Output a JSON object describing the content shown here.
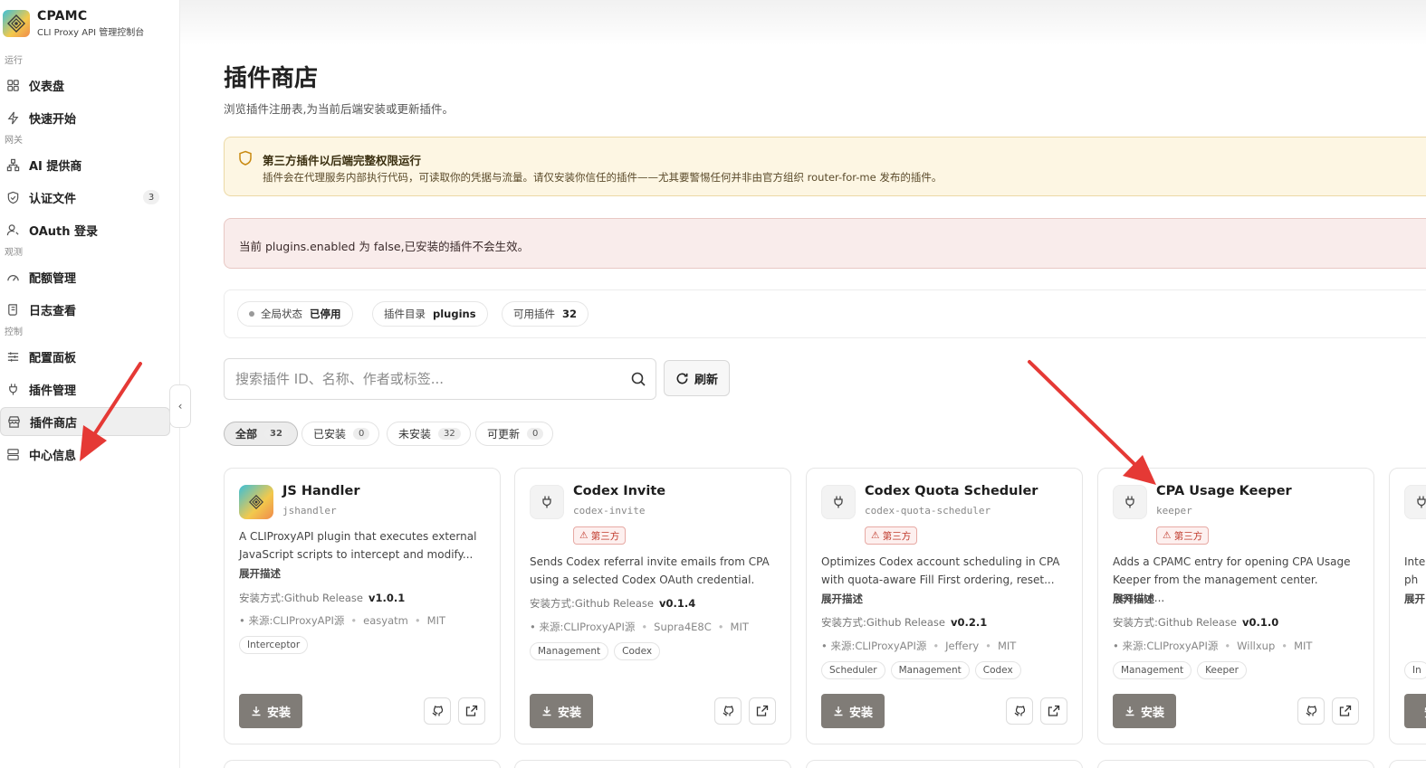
{
  "brand": {
    "name": "CPAMC",
    "subtitle": "CLI Proxy API 管理控制台"
  },
  "sidebar": {
    "sections": [
      {
        "label": "运行",
        "items": [
          {
            "label": "仪表盘"
          },
          {
            "label": "快速开始"
          }
        ]
      },
      {
        "label": "网关",
        "items": [
          {
            "label": "AI 提供商"
          },
          {
            "label": "认证文件",
            "count": "3"
          },
          {
            "label": "OAuth 登录"
          }
        ]
      },
      {
        "label": "观测",
        "items": [
          {
            "label": "配额管理"
          },
          {
            "label": "日志查看"
          }
        ]
      },
      {
        "label": "控制",
        "items": [
          {
            "label": "配置面板"
          },
          {
            "label": "插件管理"
          },
          {
            "label": "插件商店"
          },
          {
            "label": "中心信息"
          }
        ]
      }
    ],
    "active_item": "插件商店"
  },
  "page": {
    "title": "插件商店",
    "subtitle": "浏览插件注册表,为当前后端安装或更新插件。"
  },
  "warning": {
    "title": "第三方插件以后端完整权限运行",
    "description": "插件会在代理服务内部执行代码，可读取你的凭据与流量。请仅安装你信任的插件——尤其要警惕任何并非由官方组织 router-for-me 发布的插件。"
  },
  "error_notice": "当前 plugins.enabled 为 false,已安装的插件不会生效。",
  "status": {
    "global_label": "全局状态",
    "global_value": "已停用",
    "dir_label": "插件目录",
    "dir_value": "plugins",
    "available_label": "可用插件",
    "available_value": "32"
  },
  "search": {
    "placeholder": "搜索插件 ID、名称、作者或标签..."
  },
  "refresh_label": "刷新",
  "filters": [
    {
      "label": "全部",
      "count": "32"
    },
    {
      "label": "已安装",
      "count": "0"
    },
    {
      "label": "未安装",
      "count": "32"
    },
    {
      "label": "可更新",
      "count": "0"
    }
  ],
  "labels": {
    "third_party": "第三方",
    "expand": "展开描述",
    "install_method": "安装方式:",
    "source": "来源:",
    "install": "安装"
  },
  "plugins": [
    {
      "name": "JS Handler",
      "id": "jshandler",
      "third_party": false,
      "description": "A CLIProxyAPI plugin that executes external JavaScript scripts to intercept and modify...",
      "install_method": "Github Release",
      "version": "v1.0.1",
      "source": "CLIProxyAPI源",
      "author": "easyatm",
      "license": "MIT",
      "tags": [
        "Interceptor"
      ]
    },
    {
      "name": "Codex Invite",
      "id": "codex-invite",
      "third_party": true,
      "description": "Sends Codex referral invite emails from CPA using a selected Codex OAuth credential.",
      "install_method": "Github Release",
      "version": "v0.1.4",
      "source": "CLIProxyAPI源",
      "author": "Supra4E8C",
      "license": "MIT",
      "tags": [
        "Management",
        "Codex"
      ]
    },
    {
      "name": "Codex Quota Scheduler",
      "id": "codex-quota-scheduler",
      "third_party": true,
      "description": "Optimizes Codex account scheduling in CPA with quota-aware Fill First ordering, reset...",
      "install_method": "Github Release",
      "version": "v0.2.1",
      "source": "CLIProxyAPI源",
      "author": "Jeffery",
      "license": "MIT",
      "tags": [
        "Scheduler",
        "Management",
        "Codex"
      ]
    },
    {
      "name": "CPA Usage Keeper",
      "id": "keeper",
      "third_party": true,
      "description": "Adds a CPAMC entry for opening CPA Usage Keeper from the management center. Require...",
      "install_method": "Github Release",
      "version": "v0.1.0",
      "source": "CLIProxyAPI源",
      "author": "Willxup",
      "license": "MIT",
      "tags": [
        "Management",
        "Keeper"
      ]
    },
    {
      "name": "",
      "id": "",
      "third_party": true,
      "description": "Inte ph",
      "expand_partial": "展开",
      "install_partial": "安装",
      "tags": [
        "In"
      ]
    }
  ],
  "colors": {
    "warning_bg": "#fdf6e3",
    "error_bg": "#f9eceb",
    "third_party": "#c0392b",
    "install_button": "#807c77",
    "annotation_arrow": "#e53935"
  }
}
